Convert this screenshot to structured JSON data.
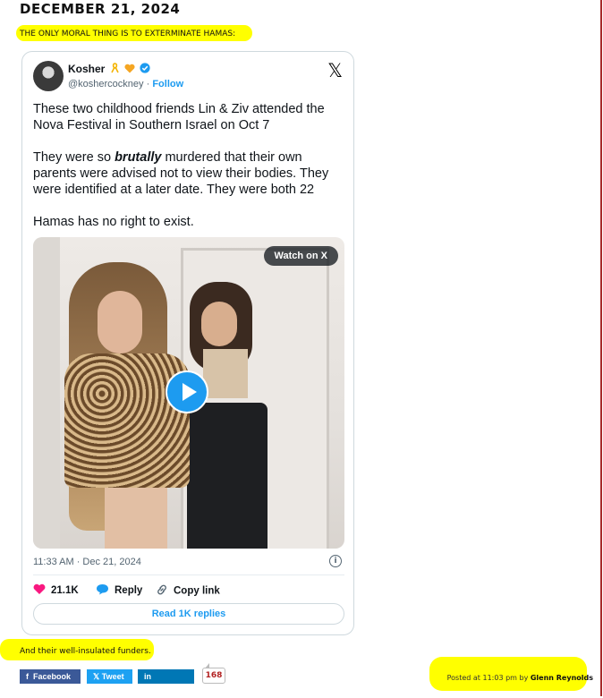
{
  "post": {
    "date": "DECEMBER 21, 2024",
    "lead": "THE ONLY MORAL THING IS TO EXTERMINATE HAMAS:"
  },
  "tweet": {
    "author_name": "Kosher",
    "author_emojis": [
      "ribbon-icon",
      "heart-icon",
      "verified-badge-icon"
    ],
    "handle": "@koshercockney",
    "separator": " · ",
    "follow_label": "Follow",
    "paragraph_1": "These two childhood friends Lin & Ziv attended the Nova Festival in Southern Israel on Oct 7",
    "paragraph_2_before": "They were so ",
    "paragraph_2_emphasis": "brutally",
    "paragraph_2_after": " murdered that their own parents were advised not to view their bodies. They were identified at a later date. They were both 22",
    "paragraph_3": "Hamas has no right to exist.",
    "watch_label": "Watch on X",
    "timestamp": "11:33 AM · Dec 21, 2024",
    "likes": "21.1K",
    "reply_label": "Reply",
    "copy_link_label": "Copy link",
    "read_replies_label": "Read 1K replies"
  },
  "footer": {
    "text": "And their well-insulated funders.",
    "share_facebook": "Facebook",
    "share_tweet": "Tweet",
    "share_linkedin": "LinkedIn",
    "share_count": "168",
    "posted_prefix": "Posted at 11:03 pm by",
    "posted_author": "Glenn Reynolds"
  },
  "colors": {
    "highlight": "#ffff00",
    "x_blue": "#1d9bf0",
    "facebook": "#3b5998",
    "twitter": "#1da1f2",
    "linkedin": "#0077b5",
    "like_pink": "#f91880"
  }
}
